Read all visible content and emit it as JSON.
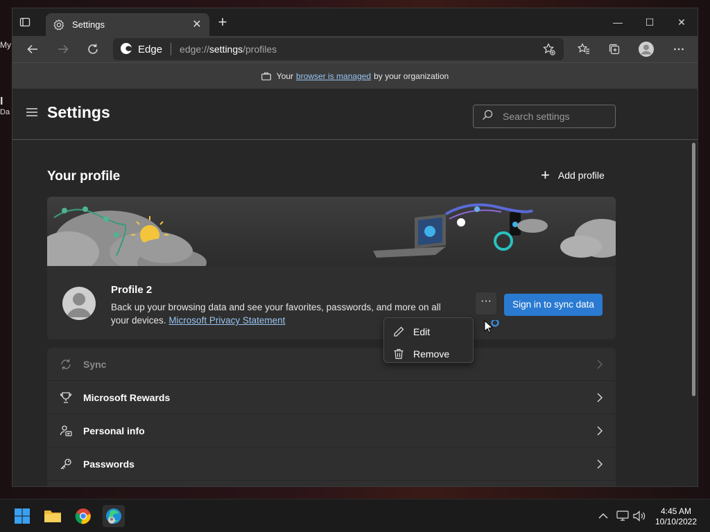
{
  "desktop": {
    "peek_1": "My",
    "peek_2": "I",
    "peek_3": "Da"
  },
  "tab": {
    "title": "Settings",
    "close": "✕",
    "new_tab": "+"
  },
  "window_controls": {
    "minimize": "—",
    "maximize": "☐",
    "close": "✕"
  },
  "address": {
    "brand": "Edge",
    "url_prefix": "edge://",
    "url_host": "settings",
    "url_path": "/profiles"
  },
  "managed": {
    "before": "Your",
    "link": "browser is managed",
    "after": "by your organization"
  },
  "settings": {
    "title": "Settings",
    "search_placeholder": "Search settings"
  },
  "profile": {
    "heading": "Your profile",
    "add_label": "Add profile",
    "name": "Profile 2",
    "description": "Back up your browsing data and see your favorites, passwords, and more on all your devices.",
    "privacy_link": "Microsoft Privacy Statement",
    "more": "···",
    "sync_button": "Sign in to sync data"
  },
  "context_menu": {
    "edit": "Edit",
    "remove": "Remove"
  },
  "list": {
    "sync": "Sync",
    "rewards": "Microsoft Rewards",
    "personal": "Personal info",
    "passwords": "Passwords"
  },
  "clock": {
    "time": "4:45 AM",
    "date": "10/10/2022"
  },
  "colors": {
    "accent": "#2a7ad1",
    "link": "#99c4f0",
    "window_bg": "#202020",
    "panel": "#2f2f2f"
  }
}
